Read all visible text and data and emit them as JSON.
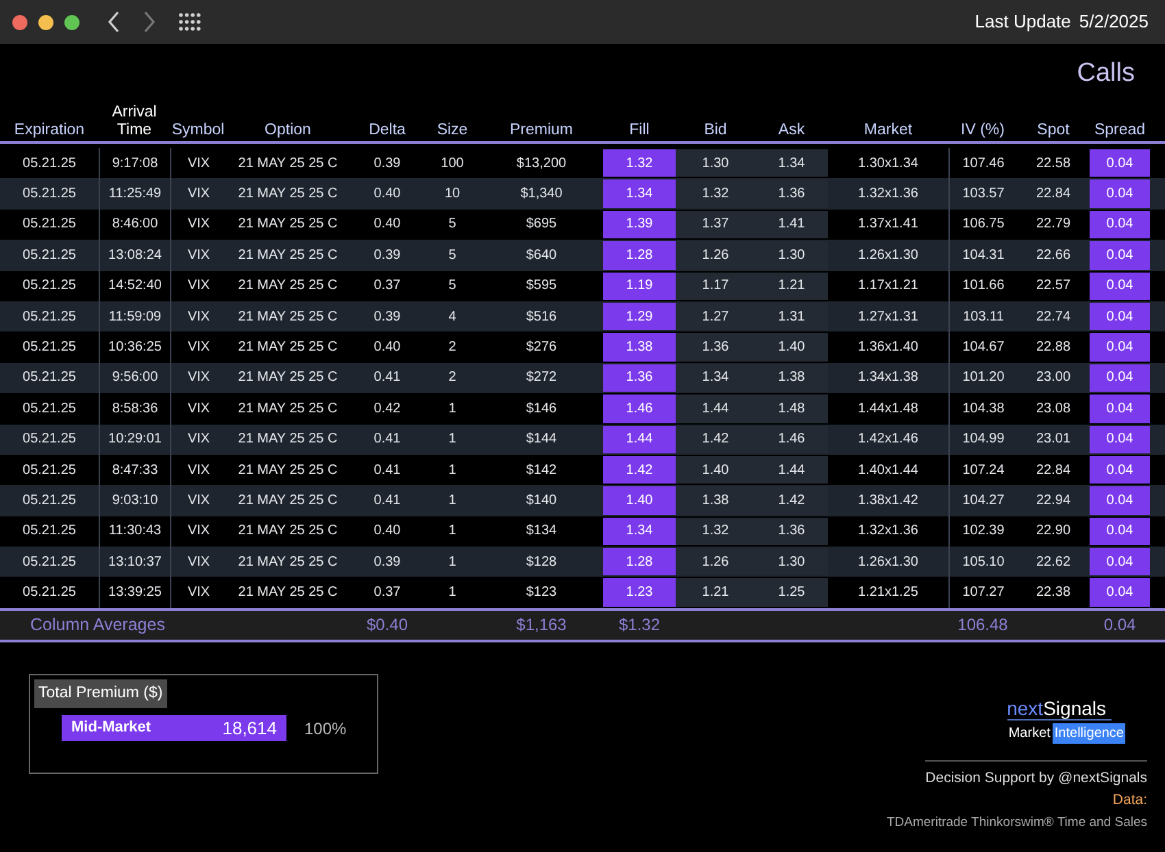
{
  "titlebar": {
    "last_update_label": "Last Update",
    "last_update_date": "5/2/2025"
  },
  "heading": "Calls",
  "columns": [
    {
      "label": "Expiration",
      "kind": "plain"
    },
    {
      "label": "Arrival Time",
      "kind": "plain"
    },
    {
      "label": "Symbol",
      "kind": "plain"
    },
    {
      "label": "Option",
      "kind": "plain"
    },
    {
      "label": "Delta",
      "kind": "plain",
      "average": "$0.40"
    },
    {
      "label": "Size",
      "kind": "plain"
    },
    {
      "label": "Premium",
      "kind": "plain",
      "average": "$1,163"
    },
    {
      "label": "Fill",
      "kind": "highlight",
      "average": "$1.32"
    },
    {
      "label": "Bid",
      "kind": "shaded"
    },
    {
      "label": "Ask",
      "kind": "shaded"
    },
    {
      "label": "Market",
      "kind": "plain"
    },
    {
      "label": "IV (%)",
      "kind": "plain",
      "average": "106.48"
    },
    {
      "label": "Spot",
      "kind": "plain"
    },
    {
      "label": "Spread",
      "kind": "highlight",
      "average": "0.04"
    }
  ],
  "rows": [
    [
      "05.21.25",
      "9:17:08",
      "VIX",
      "21 MAY 25 25 C",
      "0.39",
      "100",
      "$13,200",
      "1.32",
      "1.30",
      "1.34",
      "1.30x1.34",
      "107.46",
      "22.58",
      "0.04"
    ],
    [
      "05.21.25",
      "11:25:49",
      "VIX",
      "21 MAY 25 25 C",
      "0.40",
      "10",
      "$1,340",
      "1.34",
      "1.32",
      "1.36",
      "1.32x1.36",
      "103.57",
      "22.84",
      "0.04"
    ],
    [
      "05.21.25",
      "8:46:00",
      "VIX",
      "21 MAY 25 25 C",
      "0.40",
      "5",
      "$695",
      "1.39",
      "1.37",
      "1.41",
      "1.37x1.41",
      "106.75",
      "22.79",
      "0.04"
    ],
    [
      "05.21.25",
      "13:08:24",
      "VIX",
      "21 MAY 25 25 C",
      "0.39",
      "5",
      "$640",
      "1.28",
      "1.26",
      "1.30",
      "1.26x1.30",
      "104.31",
      "22.66",
      "0.04"
    ],
    [
      "05.21.25",
      "14:52:40",
      "VIX",
      "21 MAY 25 25 C",
      "0.37",
      "5",
      "$595",
      "1.19",
      "1.17",
      "1.21",
      "1.17x1.21",
      "101.66",
      "22.57",
      "0.04"
    ],
    [
      "05.21.25",
      "11:59:09",
      "VIX",
      "21 MAY 25 25 C",
      "0.39",
      "4",
      "$516",
      "1.29",
      "1.27",
      "1.31",
      "1.27x1.31",
      "103.11",
      "22.74",
      "0.04"
    ],
    [
      "05.21.25",
      "10:36:25",
      "VIX",
      "21 MAY 25 25 C",
      "0.40",
      "2",
      "$276",
      "1.38",
      "1.36",
      "1.40",
      "1.36x1.40",
      "104.67",
      "22.88",
      "0.04"
    ],
    [
      "05.21.25",
      "9:56:00",
      "VIX",
      "21 MAY 25 25 C",
      "0.41",
      "2",
      "$272",
      "1.36",
      "1.34",
      "1.38",
      "1.34x1.38",
      "101.20",
      "23.00",
      "0.04"
    ],
    [
      "05.21.25",
      "8:58:36",
      "VIX",
      "21 MAY 25 25 C",
      "0.42",
      "1",
      "$146",
      "1.46",
      "1.44",
      "1.48",
      "1.44x1.48",
      "104.38",
      "23.08",
      "0.04"
    ],
    [
      "05.21.25",
      "10:29:01",
      "VIX",
      "21 MAY 25 25 C",
      "0.41",
      "1",
      "$144",
      "1.44",
      "1.42",
      "1.46",
      "1.42x1.46",
      "104.99",
      "23.01",
      "0.04"
    ],
    [
      "05.21.25",
      "8:47:33",
      "VIX",
      "21 MAY 25 25 C",
      "0.41",
      "1",
      "$142",
      "1.42",
      "1.40",
      "1.44",
      "1.40x1.44",
      "107.24",
      "22.84",
      "0.04"
    ],
    [
      "05.21.25",
      "9:03:10",
      "VIX",
      "21 MAY 25 25 C",
      "0.41",
      "1",
      "$140",
      "1.40",
      "1.38",
      "1.42",
      "1.38x1.42",
      "104.27",
      "22.94",
      "0.04"
    ],
    [
      "05.21.25",
      "11:30:43",
      "VIX",
      "21 MAY 25 25 C",
      "0.40",
      "1",
      "$134",
      "1.34",
      "1.32",
      "1.36",
      "1.32x1.36",
      "102.39",
      "22.90",
      "0.04"
    ],
    [
      "05.21.25",
      "13:10:37",
      "VIX",
      "21 MAY 25 25 C",
      "0.39",
      "1",
      "$128",
      "1.28",
      "1.26",
      "1.30",
      "1.26x1.30",
      "105.10",
      "22.62",
      "0.04"
    ],
    [
      "05.21.25",
      "13:39:25",
      "VIX",
      "21 MAY 25 25 C",
      "0.37",
      "1",
      "$123",
      "1.23",
      "1.21",
      "1.25",
      "1.21x1.25",
      "107.27",
      "22.38",
      "0.04"
    ]
  ],
  "averages": {
    "label": "Column Averages"
  },
  "total_premium": {
    "title": "Total Premium ($)",
    "bars": [
      {
        "label": "Mid-Market",
        "value": "18,614",
        "percent": "100%"
      }
    ]
  },
  "branding": {
    "logo_prefix": "next",
    "logo_name": "Signals",
    "tagline_1": "Market",
    "tagline_2": "Intelligence",
    "credit": "Decision Support by @nextSignals",
    "data_label": "Data:",
    "data_source": "TDAmeritrade Thinkorswim® Time and Sales"
  }
}
